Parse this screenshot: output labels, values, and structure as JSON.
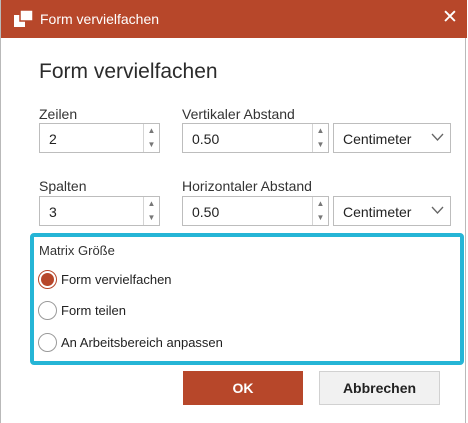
{
  "window": {
    "title": "Form vervielfachen",
    "close_glyph": "✕",
    "icon": "shape-duplicate-icon"
  },
  "dialog": {
    "heading": "Form vervielfachen"
  },
  "rows": {
    "label": "Zeilen",
    "value": "2"
  },
  "vertical_spacing": {
    "label": "Vertikaler Abstand",
    "value": "0.50",
    "unit": "Centimeter"
  },
  "columns": {
    "label": "Spalten",
    "value": "3"
  },
  "horizontal_spacing": {
    "label": "Horizontaler Abstand",
    "value": "0.50",
    "unit": "Centimeter"
  },
  "matrix": {
    "label": "Matrix Größe",
    "options": [
      {
        "label": "Form vervielfachen",
        "selected": true
      },
      {
        "label": "Form teilen",
        "selected": false
      },
      {
        "label": "An Arbeitsbereich anpassen",
        "selected": false
      }
    ]
  },
  "buttons": {
    "ok": "OK",
    "cancel": "Abbrechen"
  },
  "spinner": {
    "up": "▲",
    "down": "▼"
  },
  "colors": {
    "accent": "#b7472a",
    "focus_border": "#25b5d6"
  }
}
